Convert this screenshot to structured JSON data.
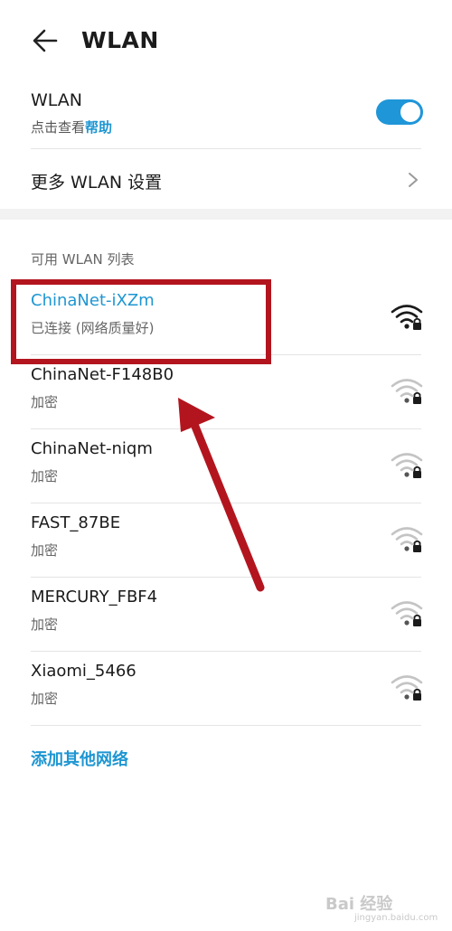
{
  "header": {
    "title": "WLAN",
    "back_icon": "back-arrow-icon"
  },
  "wlan_toggle": {
    "label": "WLAN",
    "hint_prefix": "点击查看",
    "hint_link": "帮助",
    "enabled": true
  },
  "more_settings": {
    "label": "更多 WLAN 设置"
  },
  "section": {
    "title": "可用 WLAN 列表"
  },
  "networks": [
    {
      "name": "ChinaNet-iXZm",
      "status": "已连接 (网络质量好)",
      "connected": true,
      "signal": "strong"
    },
    {
      "name": "ChinaNet-F148B0",
      "status": "加密",
      "connected": false,
      "signal": "weak"
    },
    {
      "name": "ChinaNet-niqm",
      "status": "加密",
      "connected": false,
      "signal": "weak"
    },
    {
      "name": "FAST_87BE",
      "status": "加密",
      "connected": false,
      "signal": "weak"
    },
    {
      "name": "MERCURY_FBF4",
      "status": "加密",
      "connected": false,
      "signal": "weak"
    },
    {
      "name": "Xiaomi_5466",
      "status": "加密",
      "connected": false,
      "signal": "weak"
    }
  ],
  "add_network": {
    "label": "添加其他网络"
  },
  "watermark": {
    "text": "Bai 经验",
    "sub": "jingyan.baidu.com"
  },
  "colors": {
    "accent": "#1e96d2",
    "annotation": "#b3151f"
  }
}
